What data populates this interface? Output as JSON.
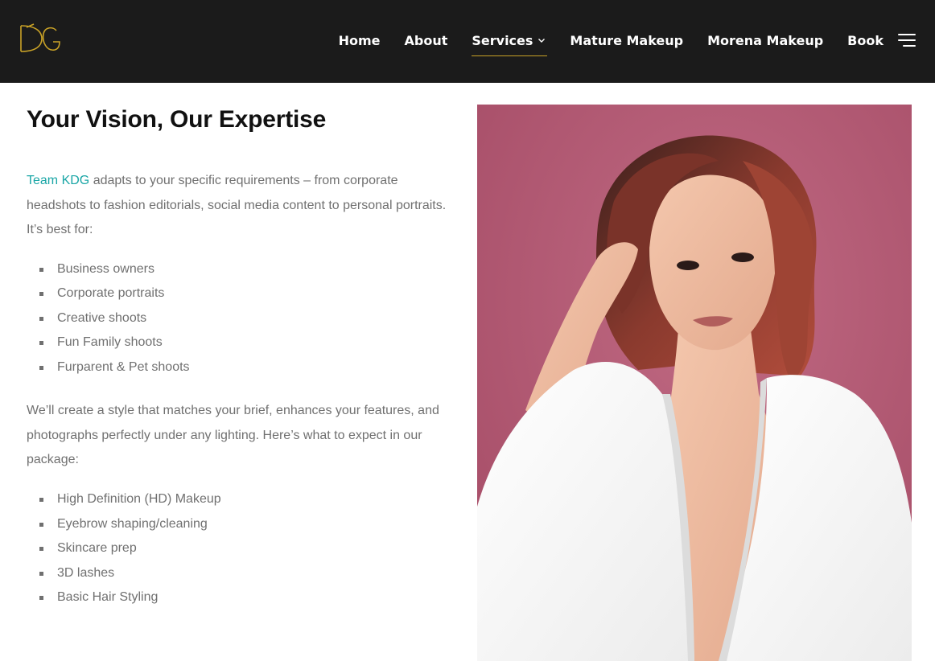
{
  "header": {
    "logo_text": "DG",
    "nav": [
      {
        "label": "Home"
      },
      {
        "label": "About"
      },
      {
        "label": "Services",
        "active": true,
        "has_dropdown": true
      },
      {
        "label": "Mature Makeup"
      },
      {
        "label": "Morena Makeup"
      },
      {
        "label": "Book"
      }
    ],
    "menu_icon": "hamburger-icon"
  },
  "main": {
    "title": "Your Vision, Our Expertise",
    "intro_highlight": "Team KDG",
    "intro_rest": " adapts to your specific requirements – from corporate headshots to fashion editorials, social media content to personal portraits. It’s best for:",
    "best_for": [
      "Business owners",
      "Corporate portraits",
      "Creative shoots",
      "Fun Family shoots",
      "Furparent & Pet shoots"
    ],
    "package_intro": "We’ll create a style that matches your brief, enhances your features, and photographs perfectly under any lighting. Here’s what to expect in our package:",
    "package_items": [
      "High Definition (HD) Makeup",
      "Eyebrow shaping/cleaning",
      "Skincare prep",
      "3D lashes",
      "Basic Hair Styling"
    ]
  },
  "colors": {
    "header_bg": "#1b1b1b",
    "accent_gold": "#c9a227",
    "link_teal": "#1aa6a6",
    "photo_bg": "#b35a74"
  }
}
